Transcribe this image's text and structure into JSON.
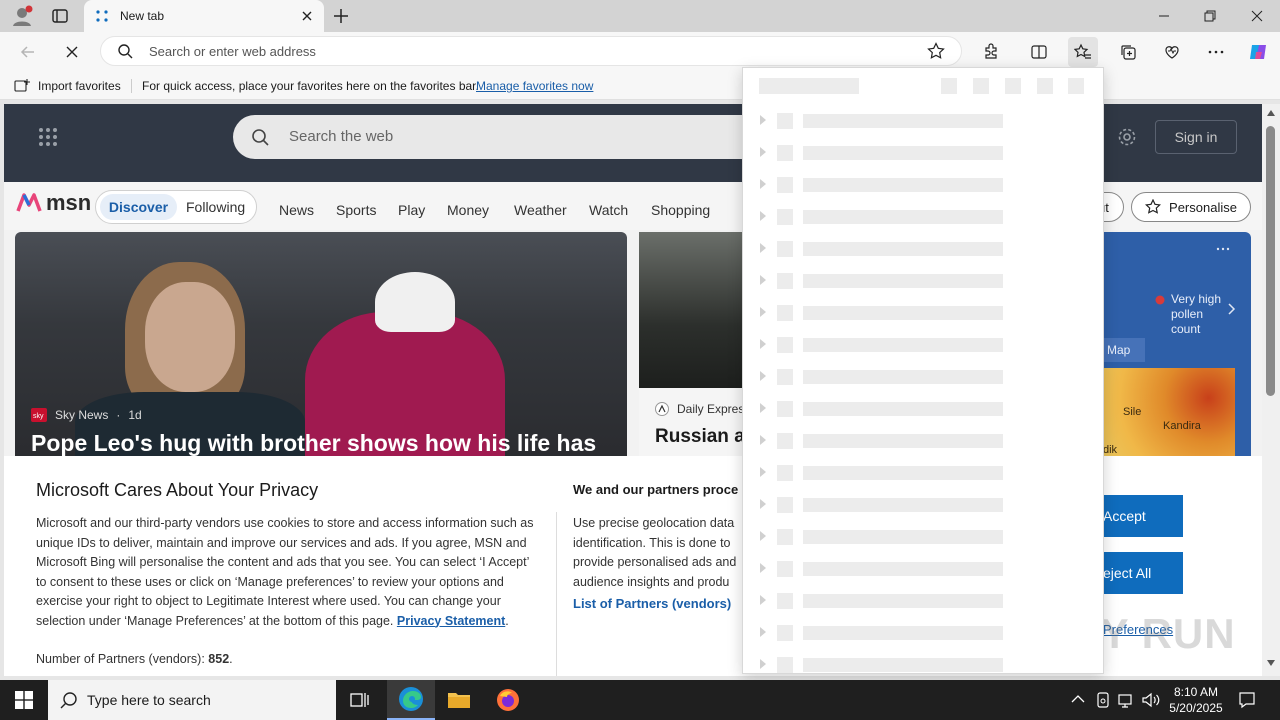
{
  "browser": {
    "tab_title": "New tab",
    "address_placeholder": "Search or enter web address"
  },
  "favorites_bar": {
    "import_label": "Import favorites",
    "message": "For quick access, place your favorites here on the favorites bar.",
    "manage_link": "Manage favorites now"
  },
  "msn": {
    "search_placeholder": "Search the web",
    "sign_in": "Sign in",
    "logo_text": "msn",
    "tabs": [
      "Discover",
      "Following"
    ],
    "nav": [
      "News",
      "Sports",
      "Play",
      "Money",
      "Weather",
      "Watch",
      "Shopping"
    ],
    "about_partial": "ut",
    "personalise": "Personalise",
    "hero": {
      "source": "Sky News",
      "age": "1d",
      "headline": "Pope Leo's hug with brother shows how his life has"
    },
    "card2": {
      "source": "Daily Expres",
      "headline": "Russian ar"
    },
    "weather": {
      "pollen": "Very high pollen count",
      "map_tab": "Map",
      "map_labels": [
        "Sile",
        "Kandira",
        "dik"
      ]
    }
  },
  "consent": {
    "title": "Microsoft Cares About Your Privacy",
    "body_1": "Microsoft and our third-party vendors use cookies to store and access information such as unique IDs to deliver, maintain and improve our services and ads. If you agree, MSN and Microsoft Bing will personalise the content and ads that you see. You can select ‘I Accept’ to consent to these uses or click on ‘Manage preferences’ to review your options and exercise your right to object to Legitimate Interest where used.  You can change your selection under ‘Manage Preferences’ at the bottom of this page.",
    "privacy_link": "Privacy Statement",
    "partners_label": "Number of Partners (vendors):",
    "partners_count": "852",
    "right_title": "We and our partners proce",
    "right_body": [
      "Use precise geolocation data",
      "identification. This is done to",
      "provide personalised ads and",
      "audience insights and produ"
    ],
    "vendors_link": "List of Partners (vendors)",
    "accept": "Accept",
    "reject": "eject All",
    "manage": "Preferences"
  },
  "watermark": "ANY RUN",
  "taskbar": {
    "search_placeholder": "Type here to search",
    "time": "8:10 AM",
    "date": "5/20/2025"
  }
}
